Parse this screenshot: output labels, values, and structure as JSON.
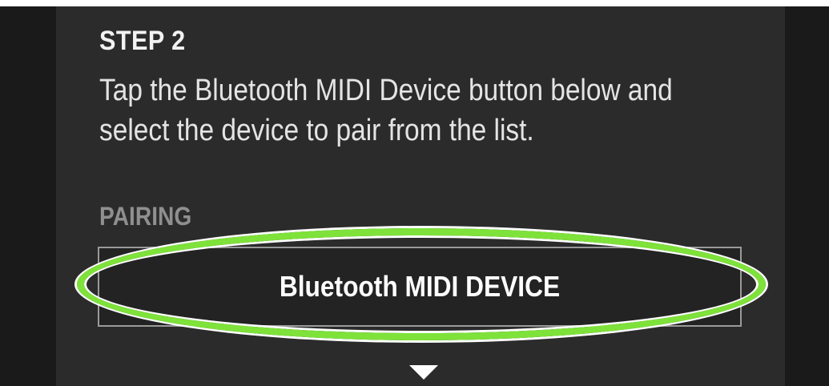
{
  "step": {
    "title": "STEP 2",
    "instruction": "Tap the Bluetooth MIDI Device button below and select the device to pair from the list."
  },
  "pairing": {
    "section_label": "PAIRING",
    "button_label": "Bluetooth MIDI DEVICE"
  },
  "icons": {
    "scroll_indicator": "triangle-down-icon"
  },
  "colors": {
    "highlight": "#7ee23a",
    "panel_bg": "#2b2b2b",
    "outer_bg": "#1a1a1a"
  }
}
